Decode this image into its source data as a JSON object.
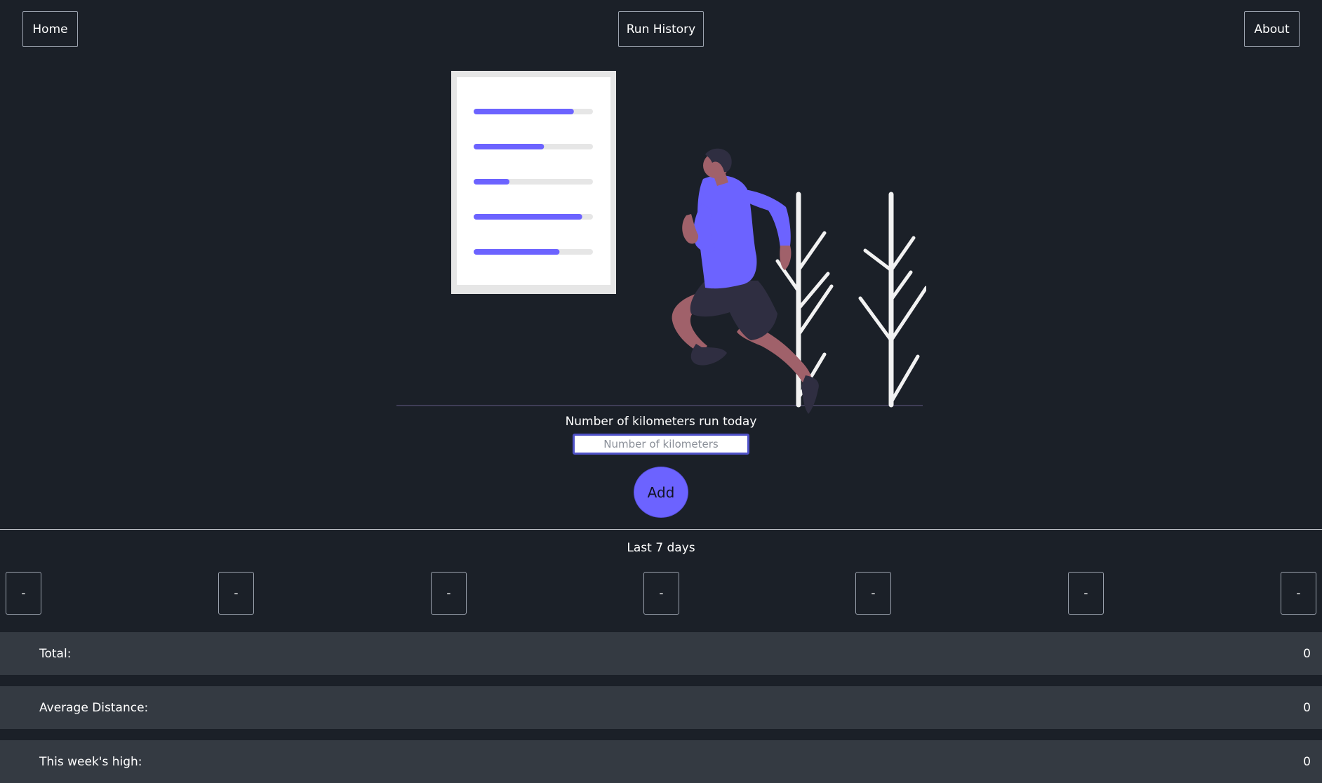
{
  "nav": {
    "home_label": "Home",
    "history_label": "Run History",
    "about_label": "About"
  },
  "form": {
    "label": "Number of kilometers run today",
    "placeholder": "Number of kilometers",
    "value": "",
    "add_label": "Add"
  },
  "week": {
    "title": "Last 7 days",
    "days": [
      "-",
      "-",
      "-",
      "-",
      "-",
      "-",
      "-"
    ]
  },
  "stats": {
    "total_label": "Total:",
    "total_value": "0",
    "average_label": "Average Distance:",
    "average_value": "0",
    "high_label": "This week's high:",
    "high_value": "0"
  },
  "colors": {
    "background": "#1b2028",
    "accent": "#6c63ff",
    "stat_row": "#343a42"
  },
  "illustration": {
    "icon": "runner-with-checklist-illustration",
    "checklist_progress": [
      0.84,
      0.59,
      0.3,
      0.91,
      0.72
    ]
  }
}
